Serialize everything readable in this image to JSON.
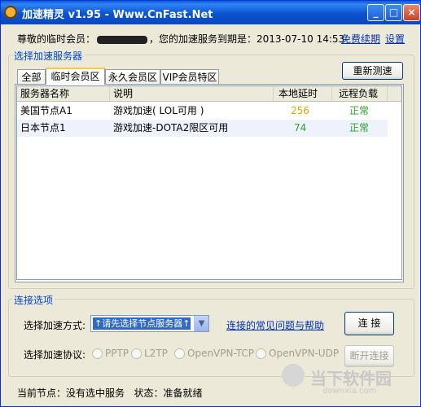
{
  "window": {
    "title": "加速精灵 v1.95 - Www.CnFast.Net"
  },
  "titlebar_buttons": {
    "min": "_",
    "max": "□",
    "close": "×"
  },
  "info": {
    "prefix": "尊敬的临时会员：",
    "suffix": "，您的加速服务到期是：2013-07-10 14:53"
  },
  "top_links": {
    "renew": "免费续期",
    "settings": "设置"
  },
  "server_group": {
    "title": "选择加速服务器",
    "refresh_label": "重新测速",
    "tabs": [
      {
        "label": "全部",
        "active": false
      },
      {
        "label": "临时会员区",
        "active": true
      },
      {
        "label": "永久会员区",
        "active": false
      },
      {
        "label": "VIP会员特区",
        "active": false
      }
    ],
    "columns": [
      "服务器名称",
      "说明",
      "本地延时",
      "远程负载"
    ],
    "rows": [
      {
        "name": "美国节点A1",
        "desc": "游戏加速( LOL可用 )",
        "latency": "256",
        "load": "正常",
        "latency_color": "#d8a800",
        "load_color": "#2e9e2e"
      },
      {
        "name": "日本节点1",
        "desc": "游戏加速-DOTA2限区可用",
        "latency": "74",
        "load": "正常",
        "latency_color": "#2e9e2e",
        "load_color": "#2e9e2e"
      }
    ]
  },
  "connect_group": {
    "title": "连接选项",
    "method_label": "选择加速方式:",
    "method_value": "↑请先选择节点服务器↑",
    "help_link": "连接的常见问题与帮助",
    "connect_label": "连 接",
    "protocol_label": "选择加速协议:",
    "protocols": [
      "PPTP",
      "L2TP",
      "OpenVPN-TCP",
      "OpenVPN-UDP"
    ],
    "disconnect_label": "断开连接"
  },
  "status": {
    "node_label": "当前节点：",
    "node_value": "没有选中服务",
    "state_label": "状态：",
    "state_value": "准备就绪"
  },
  "watermark": {
    "text": "当下软件园",
    "sub": "downxia.com"
  }
}
